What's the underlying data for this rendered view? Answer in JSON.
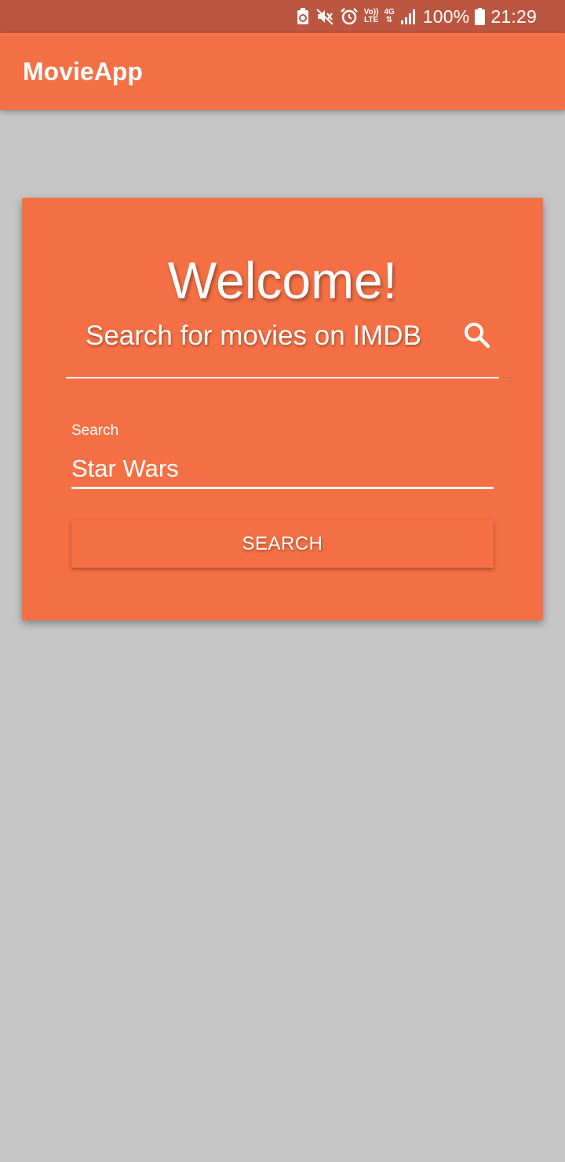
{
  "status_bar": {
    "volte_top": "Vo))",
    "volte_bottom": "LTE",
    "network_type": "4G",
    "battery_percent": "100%",
    "time": "21:29",
    "icons": [
      "battery-saver-icon",
      "mute-icon",
      "alarm-icon",
      "volte-icon",
      "network-4g-icon",
      "signal-icon",
      "battery-icon"
    ]
  },
  "app_bar": {
    "title": "MovieApp",
    "color": "#f47044"
  },
  "card": {
    "welcome": "Welcome!",
    "subtitle": "Search for movies on IMDB",
    "icon": "search-icon",
    "search_field": {
      "label": "Search",
      "value": "Star Wars"
    },
    "button_label": "SEARCH"
  },
  "colors": {
    "accent": "#f47044",
    "status_bar": "#bb5641",
    "background": "#c6c6c6"
  }
}
